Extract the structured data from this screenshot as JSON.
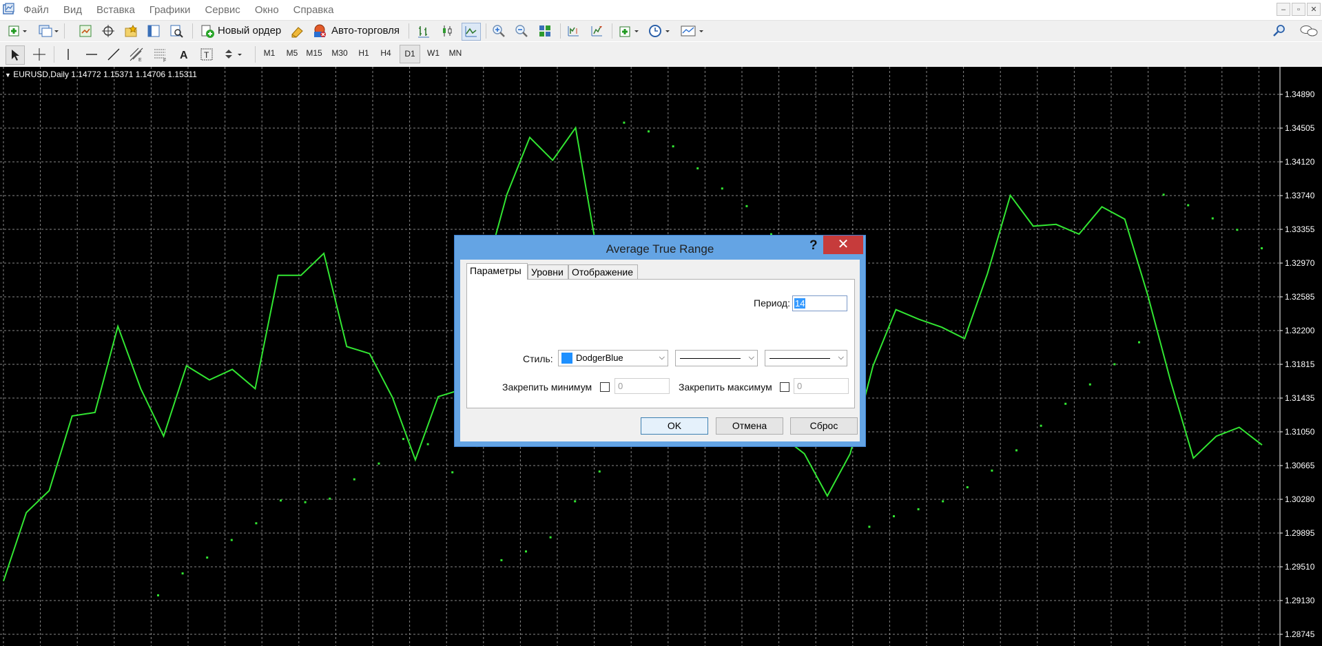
{
  "menu": [
    "Файл",
    "Вид",
    "Вставка",
    "Графики",
    "Сервис",
    "Окно",
    "Справка"
  ],
  "toolbar": {
    "new_order_label": "Новый ордер",
    "autotrading_label": "Авто-торговля"
  },
  "timeframes": [
    "M1",
    "M5",
    "M15",
    "M30",
    "H1",
    "H4",
    "D1",
    "W1",
    "MN"
  ],
  "active_timeframe": "D1",
  "chart": {
    "header": "EURUSD,Daily  1.14772 1.15371 1.14706 1.15311",
    "line_color": "#32e632",
    "grid_color": "#888888"
  },
  "chart_data": {
    "type": "line",
    "title": "EURUSD,Daily",
    "ohlc": [
      1.14772,
      1.15371,
      1.14706,
      1.15311
    ],
    "y_tick_labels": [
      "1.34890",
      "1.34505",
      "1.34120",
      "1.33740",
      "1.33355",
      "1.32970",
      "1.32585",
      "1.32200",
      "1.31815",
      "1.31435",
      "1.31050",
      "1.30665",
      "1.30280",
      "1.29895",
      "1.29510",
      "1.29130",
      "1.28745"
    ],
    "ylim": [
      1.28745,
      1.3489
    ],
    "series": [
      {
        "values": [
          1.2935,
          1.3013,
          1.3038,
          1.3123,
          1.3127,
          1.3225,
          1.3154,
          1.31,
          1.318,
          1.3164,
          1.3176,
          1.3154,
          1.3283,
          1.3283,
          1.3308,
          1.3202,
          1.3194,
          1.3144,
          1.3073,
          1.3145,
          1.3153,
          1.328,
          1.3375,
          1.344,
          1.3414,
          1.3451,
          1.33,
          1.325,
          1.323,
          1.32,
          1.318,
          1.316,
          1.314,
          1.312,
          1.31,
          1.308,
          1.3032,
          1.308,
          1.318,
          1.3244,
          1.3233,
          1.3224,
          1.3211,
          1.3285,
          1.3374,
          1.3339,
          1.3341,
          1.333,
          1.3361,
          1.3347,
          1.3261,
          1.3163,
          1.3075,
          1.31,
          1.311,
          1.309
        ]
      },
      {
        "type": "scatter",
        "values": [
          1.292,
          1.2945,
          1.2963,
          1.2983,
          1.3002,
          1.3028,
          1.3026,
          1.303,
          1.3052,
          1.307,
          1.3098,
          1.3092,
          1.306,
          1.309,
          1.296,
          1.297,
          1.2986,
          1.3027,
          1.3061,
          1.3458,
          1.3448,
          1.3431,
          1.3406,
          1.3383,
          1.3363,
          1.3331,
          1.3308,
          1.3278,
          1.3263,
          1.2998,
          1.301,
          1.3018,
          1.3027,
          1.3043,
          1.3062,
          1.3085,
          1.3113,
          1.3138,
          1.316,
          1.3183,
          1.3208,
          1.3376,
          1.3364,
          1.3349,
          1.3336,
          1.3315
        ]
      }
    ]
  },
  "dialog": {
    "title": "Average True Range",
    "help": "?",
    "tabs": [
      "Параметры",
      "Уровни",
      "Отображение"
    ],
    "period_label": "Период:",
    "period_value": "14",
    "style_label": "Стиль:",
    "color_name": "DodgerBlue",
    "color_hex": "#1e90ff",
    "fix_min_label": "Закрепить минимум",
    "fix_min_value": "0",
    "fix_max_label": "Закрепить максимум",
    "fix_max_value": "0",
    "ok_label": "OK",
    "cancel_label": "Отмена",
    "reset_label": "Сброс"
  }
}
